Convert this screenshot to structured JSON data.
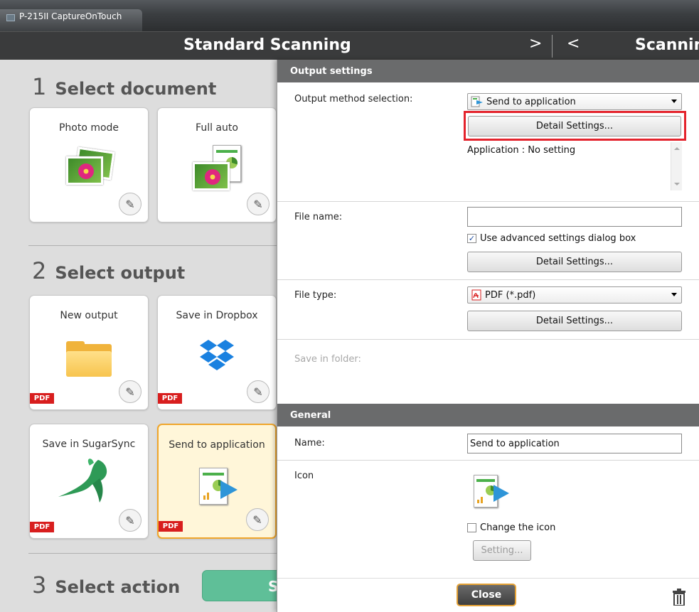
{
  "window": {
    "title": "P-215II CaptureOnTouch"
  },
  "header": {
    "title": "Standard Scanning",
    "next_arrow": ">",
    "prev_arrow": "<",
    "title_right": "Scanning"
  },
  "left": {
    "section1": {
      "num": "1",
      "title": "Select document"
    },
    "section2": {
      "num": "2",
      "title": "Select output"
    },
    "section3": {
      "num": "3",
      "title": "Select action"
    },
    "documents": [
      {
        "label": "Photo mode"
      },
      {
        "label": "Full auto"
      }
    ],
    "outputs": [
      {
        "label": "New output",
        "badge": "PDF"
      },
      {
        "label": "Save in Dropbox",
        "badge": "PDF"
      },
      {
        "label": "Save in SugarSync",
        "badge": "PDF"
      },
      {
        "label": "Send to application",
        "badge": "PDF",
        "selected": true
      }
    ],
    "action_button": {
      "label": "S"
    }
  },
  "panel": {
    "output_settings": {
      "heading": "Output settings",
      "method_label": "Output method selection:",
      "method_value": "Send to application",
      "detail_button": "Detail Settings...",
      "application_info": "Application : No setting",
      "filename_label": "File name:",
      "filename_value": "",
      "advanced_checkbox": "Use advanced settings dialog box",
      "advanced_checked": true,
      "filename_detail_button": "Detail Settings...",
      "filetype_label": "File type:",
      "filetype_value": "PDF (*.pdf)",
      "filetype_detail_button": "Detail Settings...",
      "save_folder_label": "Save in folder:"
    },
    "general": {
      "heading": "General",
      "name_label": "Name:",
      "name_value": "Send to application",
      "icon_label": "Icon",
      "change_icon_checkbox": "Change the icon",
      "change_icon_checked": false,
      "setting_button": "Setting..."
    },
    "footer": {
      "close_button": "Close"
    }
  },
  "colors": {
    "highlight": "#e4232c",
    "selected_card_border": "#f0a62c",
    "pdf_badge": "#d81e1e",
    "header_bg": "#3a3b3c",
    "section_head_bg": "#6a6b6c"
  }
}
